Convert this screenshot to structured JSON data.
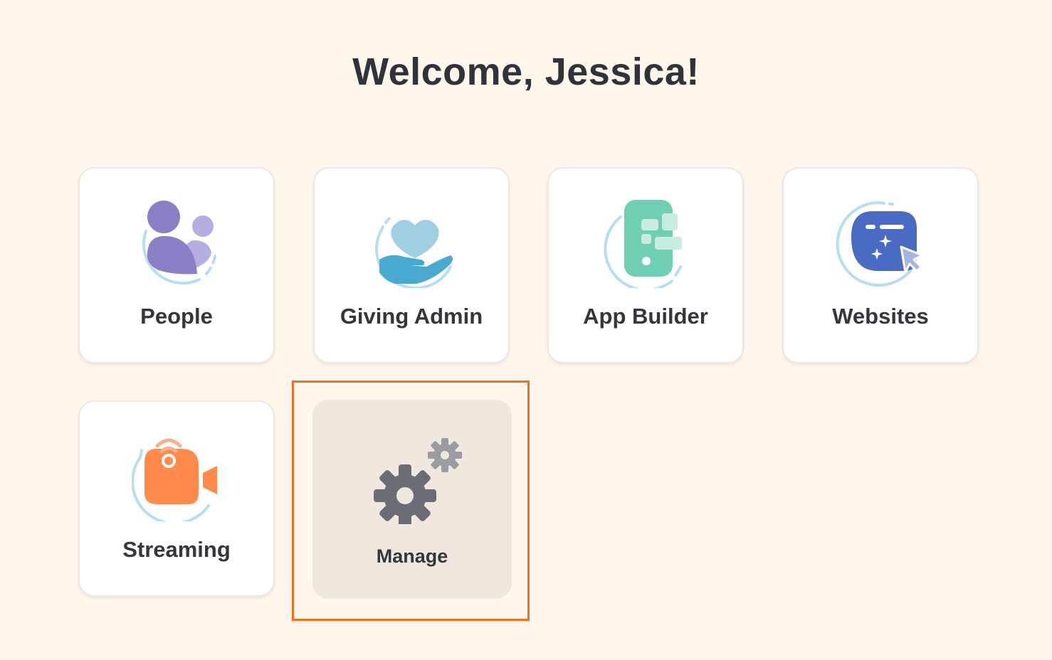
{
  "header": {
    "title": "Welcome, Jessica!"
  },
  "apps": [
    {
      "label": "People",
      "icon": "people-icon"
    },
    {
      "label": "Giving Admin",
      "icon": "giving-hand-heart-icon"
    },
    {
      "label": "App Builder",
      "icon": "app-builder-phone-icon"
    },
    {
      "label": "Websites",
      "icon": "website-cursor-icon"
    },
    {
      "label": "Streaming",
      "icon": "streaming-camera-icon"
    },
    {
      "label": "Manage",
      "icon": "gears-icon"
    }
  ],
  "colors": {
    "background": "#fff6ec",
    "tile": "#ffffff",
    "manage_tile": "#f0e7de",
    "highlight": "#f36f1c",
    "people": "#8b7fc8",
    "giving": "#4aa9cf",
    "app_builder": "#6fcfb5",
    "websites": "#4a6bc3",
    "streaming": "#ff8a4c",
    "manage": "#6b6d75"
  }
}
